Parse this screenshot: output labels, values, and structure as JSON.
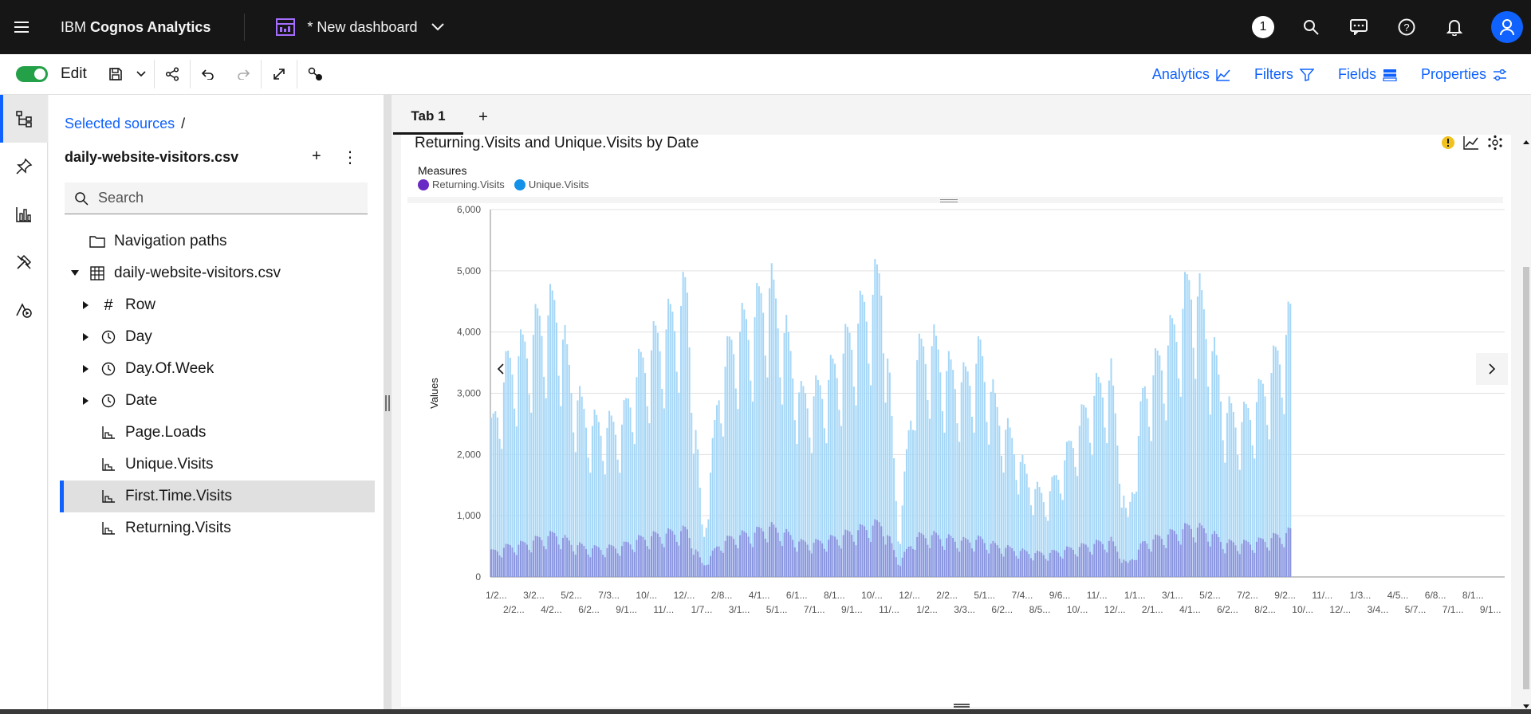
{
  "app": {
    "brand_prefix": "IBM ",
    "brand_name": "Cognos Analytics",
    "dashboard_title": "* New dashboard",
    "notification_count": "1",
    "icons": [
      "menu-icon",
      "dashboard-icon",
      "chevron-down-icon",
      "search-icon",
      "chat-icon",
      "help-icon",
      "bell-icon",
      "user-icon"
    ]
  },
  "toolbar": {
    "edit_label": "Edit",
    "edit_on": true,
    "analytics_label": "Analytics",
    "filters_label": "Filters",
    "fields_label": "Fields",
    "properties_label": "Properties"
  },
  "sources": {
    "crumb_label": "Selected sources",
    "crumb_separator": "/",
    "title": "daily-website-visitors.csv",
    "add_label": "+",
    "more_label": "⋮",
    "search_placeholder": "Search",
    "nav_paths_label": "Navigation paths",
    "nav_paths_add": "+",
    "file_label": "daily-website-visitors.csv",
    "fields": [
      {
        "label": "Row",
        "icon": "hash-icon",
        "expandable": true
      },
      {
        "label": "Day",
        "icon": "clock-icon",
        "expandable": true
      },
      {
        "label": "Day.Of.Week",
        "icon": "clock-icon",
        "expandable": true
      },
      {
        "label": "Date",
        "icon": "clock-icon",
        "expandable": true
      },
      {
        "label": "Page.Loads",
        "icon": "measure-icon",
        "expandable": false
      },
      {
        "label": "Unique.Visits",
        "icon": "measure-icon",
        "expandable": false
      },
      {
        "label": "First.Time.Visits",
        "icon": "measure-icon",
        "expandable": false,
        "selected": true
      },
      {
        "label": "Returning.Visits",
        "icon": "measure-icon",
        "expandable": false
      }
    ]
  },
  "tabs": [
    {
      "label": "Tab 1",
      "active": true
    }
  ],
  "tab_add_label": "+",
  "widget": {
    "title": "Returning.Visits and Unique.Visits by Date",
    "legend_title": "Measures",
    "legend": [
      {
        "name": "Returning.Visits",
        "color": "#6929c4"
      },
      {
        "name": "Unique.Visits",
        "color": "#1192e8"
      }
    ]
  },
  "chart_data": {
    "type": "bar",
    "title": "Returning.Visits and Unique.Visits by Date",
    "ylabel": "Values",
    "xlabel": "",
    "ylim": [
      0,
      6000
    ],
    "yticks": [
      "6,000",
      "5,000",
      "4,000",
      "3,000",
      "2,000",
      "1,000",
      "0"
    ],
    "x_tick_labels_row1": [
      "1/2...",
      "3/2...",
      "5/2...",
      "7/3...",
      "10/...",
      "12/...",
      "2/8...",
      "4/1...",
      "6/1...",
      "8/1...",
      "10/...",
      "12/...",
      "2/2...",
      "5/1...",
      "7/4...",
      "9/6...",
      "11/...",
      "1/1...",
      "3/1...",
      "5/2...",
      "7/2...",
      "9/2...",
      "11/...",
      "1/3...",
      "4/5...",
      "6/8...",
      "8/1..."
    ],
    "x_tick_labels_row2": [
      "2/2...",
      "4/2...",
      "6/2...",
      "9/1...",
      "11/...",
      "1/7...",
      "3/1...",
      "5/1...",
      "7/1...",
      "9/1...",
      "11/...",
      "1/2...",
      "3/3...",
      "6/2...",
      "8/5...",
      "10/...",
      "12/...",
      "2/1...",
      "4/1...",
      "6/2...",
      "8/2...",
      "10/...",
      "12/...",
      "3/4...",
      "5/7...",
      "7/1...",
      "9/1..."
    ],
    "series": [
      {
        "name": "Unique.Visits",
        "color": "#a6d7f7",
        "envelope": [
          2600,
          3800,
          4100,
          4600,
          4900,
          3400,
          2750,
          2700,
          2750,
          3700,
          4200,
          4600,
          5100,
          600,
          3500,
          4400,
          4600,
          5300,
          4400,
          3200,
          3300,
          3700,
          4300,
          4900,
          5450,
          600,
          3900,
          4200,
          3700,
          3500,
          4000,
          3000,
          2400,
          1700,
          1400,
          2000,
          2700,
          3300,
          3600,
          900,
          3300,
          3900,
          4500,
          5400,
          4400,
          3000,
          2800,
          3200,
          3800,
          4600
        ]
      },
      {
        "name": "Returning.Visits",
        "color": "#8a95e0",
        "envelope": [
          450,
          550,
          600,
          700,
          780,
          600,
          520,
          520,
          560,
          680,
          750,
          800,
          850,
          200,
          600,
          750,
          780,
          920,
          800,
          620,
          620,
          700,
          800,
          900,
          980,
          250,
          720,
          760,
          700,
          650,
          680,
          560,
          500,
          440,
          420,
          480,
          540,
          600,
          660,
          220,
          620,
          720,
          820,
          930,
          820,
          620,
          600,
          640,
          720,
          820
        ]
      }
    ],
    "data_extent_fraction": 0.79
  }
}
